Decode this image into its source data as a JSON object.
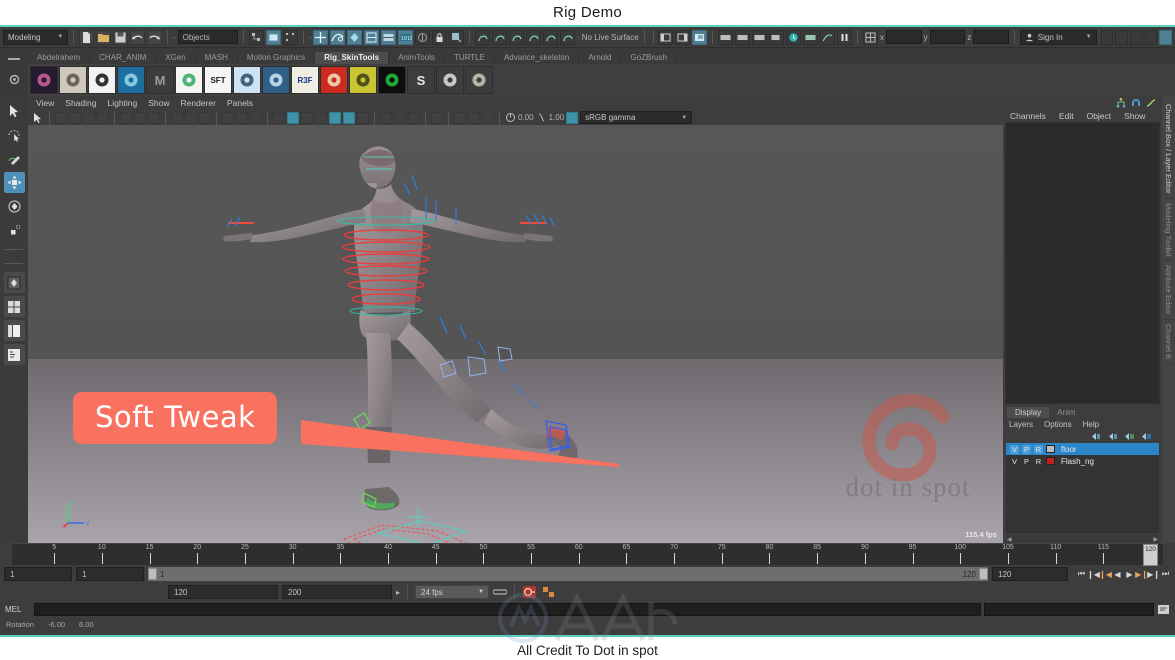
{
  "window": {
    "title": "Rig Demo",
    "caption": "All Credit To  Dot in spot"
  },
  "status_line": {
    "menu_set": "Modeling",
    "selection_mask_label": "Objects",
    "live_surface_label": "No Live Surface",
    "sign_in_label": "Sign In",
    "coord_x": "x",
    "coord_y": "y",
    "coord_z": "z",
    "coord_x_value": "",
    "coord_y_value": "",
    "coord_z_value": ""
  },
  "shelf": {
    "tabs": [
      "Abdelrahem",
      "CHAR_ANIM",
      "XGen",
      "MASH",
      "Motion Graphics",
      "Rig_SkinTools",
      "AnimTools",
      "TURTLE",
      "Advance_skeleton",
      "Arnold",
      "GoZBrush"
    ],
    "active_tab": "Rig_SkinTools",
    "icons": [
      {
        "name": "paint-skin-weights-icon",
        "glyph": "",
        "bg": "#241c2e",
        "fg": "#d45fa0"
      },
      {
        "name": "head-model-icon",
        "glyph": "",
        "bg": "#cfc8bd",
        "fg": "#5d5248"
      },
      {
        "name": "bw-atom-icon",
        "glyph": "",
        "bg": "#f2f2f2",
        "fg": "#111111"
      },
      {
        "name": "blue-orb-icon",
        "glyph": "",
        "bg": "#1d6fa0",
        "fg": "#9fd9ef"
      },
      {
        "name": "maya-m-icon",
        "glyph": "M",
        "bg": "#3d3d3d",
        "fg": "#9a9a9a"
      },
      {
        "name": "green-rig-icon",
        "glyph": "",
        "bg": "#f4f4f4",
        "fg": "#2fa75f"
      },
      {
        "name": "soft-tweak-icon",
        "glyph": "SFT",
        "bg": "#f5f5f5",
        "fg": "#1a1a1a"
      },
      {
        "name": "curve-sketch-icon",
        "glyph": "",
        "bg": "#cfe3f2",
        "fg": "#2a4b66"
      },
      {
        "name": "list-panel-icon",
        "glyph": "",
        "bg": "#2f5f86",
        "fg": "#cfe6f5"
      },
      {
        "name": "r3f-icon",
        "glyph": "R3F",
        "bg": "#f0ede3",
        "fg": "#1a2f8a"
      },
      {
        "name": "red-character-icon",
        "glyph": "",
        "bg": "#cc2b20",
        "fg": "#f5e3c0"
      },
      {
        "name": "yellow-character-icon",
        "glyph": "",
        "bg": "#c8c432",
        "fg": "#3b3b10"
      },
      {
        "name": "green-ring-icon",
        "glyph": "",
        "bg": "#0d0d0d",
        "fg": "#26c541"
      },
      {
        "name": "s-letter-icon",
        "glyph": "S",
        "bg": "#3d3d3d",
        "fg": "#e8e8e8"
      },
      {
        "name": "bunny-icon",
        "glyph": "",
        "bg": "#3d3d3d",
        "fg": "#e0e0e0"
      },
      {
        "name": "egg-icon",
        "glyph": "",
        "bg": "#3d3d3d",
        "fg": "#cfc8bd"
      }
    ]
  },
  "viewport": {
    "menus": [
      "View",
      "Shading",
      "Lighting",
      "Show",
      "Renderer",
      "Panels"
    ],
    "exposure_value": "0.00",
    "gamma_value": "1.00",
    "color_profile": "sRGB gamma",
    "fps_counter": "115.4 fps",
    "watermark_text": "dot in spot",
    "callout_label": "Soft Tweak",
    "callout_color": "#f9715f",
    "axis_labels": [
      "x",
      "y",
      "z"
    ]
  },
  "channel_box": {
    "menus": [
      "Channels",
      "Edit",
      "Object",
      "Show"
    ]
  },
  "layer_editor": {
    "tabs": [
      "Display",
      "Anim"
    ],
    "active_tab": "Display",
    "menus": [
      "Layers",
      "Options",
      "Help"
    ],
    "layers": [
      {
        "flags": [
          "V",
          "P",
          "R"
        ],
        "name": "floor",
        "color": "#b9bcc0",
        "selected": true
      },
      {
        "flags": [
          "V",
          "P",
          "R"
        ],
        "name": "Flash_ng",
        "color": "#c42020",
        "selected": false
      }
    ]
  },
  "right_dock_tabs": [
    "Channel Box / Layer Editor",
    "Modeling Toolkit",
    "Attribute Editor",
    "Channel B"
  ],
  "timeline": {
    "ticks": [
      5,
      10,
      15,
      20,
      25,
      30,
      35,
      40,
      45,
      50,
      55,
      60,
      65,
      70,
      75,
      80,
      85,
      90,
      95,
      100,
      105,
      110,
      115
    ],
    "start": 1,
    "end": 120,
    "current_frame": "120",
    "playhead_label": "120"
  },
  "range_slider": {
    "anim_start": "1",
    "range_start": "1",
    "slider_min_label": "1",
    "slider_max_label": "120",
    "range_end": "120",
    "anim_end": "200",
    "current_frame_field": "120",
    "playback_speed": "24 fps"
  },
  "command_line": {
    "label": "MEL",
    "input_value": "",
    "status_label": "Rotation",
    "status_value_1": "-6.00",
    "status_value_2": "6.00"
  }
}
